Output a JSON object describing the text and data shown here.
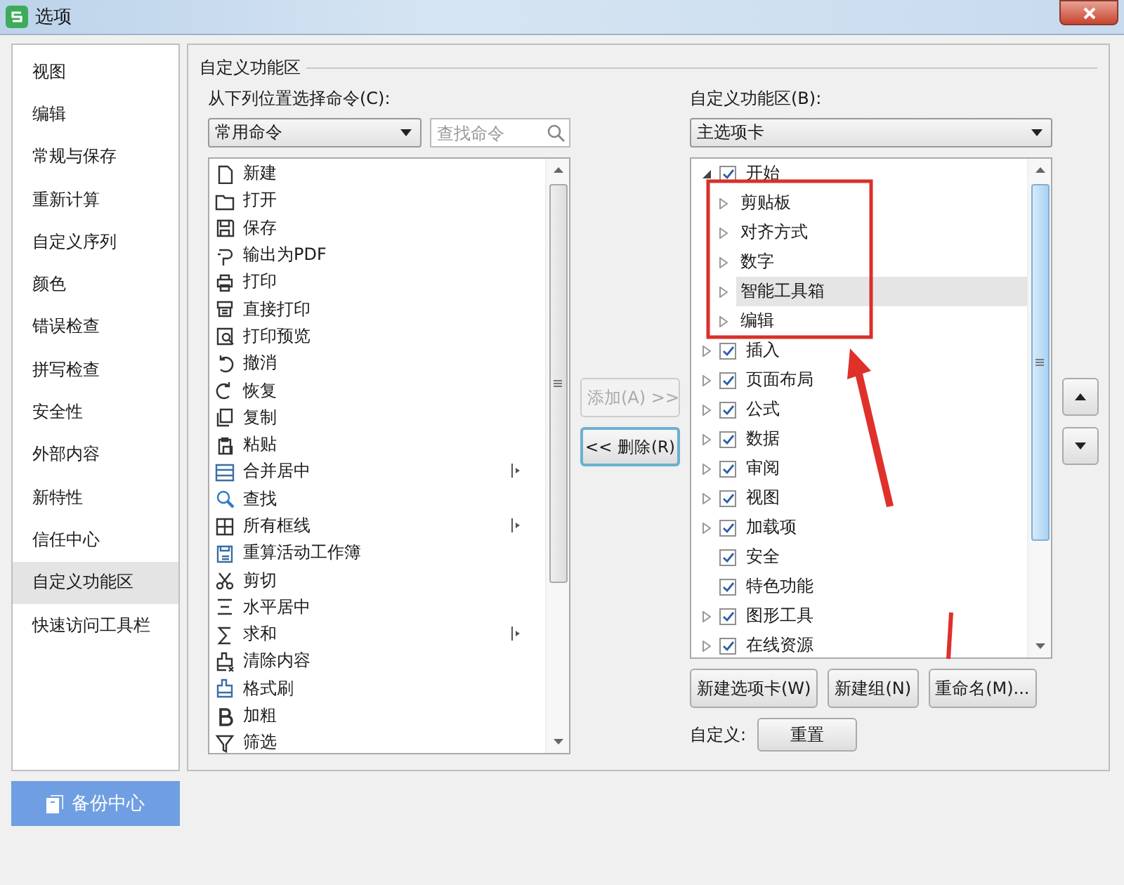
{
  "window": {
    "title": "选项"
  },
  "sidebar": {
    "items": [
      {
        "label": "视图",
        "selected": false
      },
      {
        "label": "编辑",
        "selected": false
      },
      {
        "label": "常规与保存",
        "selected": false
      },
      {
        "label": "重新计算",
        "selected": false
      },
      {
        "label": "自定义序列",
        "selected": false
      },
      {
        "label": "颜色",
        "selected": false
      },
      {
        "label": "错误检查",
        "selected": false
      },
      {
        "label": "拼写检查",
        "selected": false
      },
      {
        "label": "安全性",
        "selected": false
      },
      {
        "label": "外部内容",
        "selected": false
      },
      {
        "label": "新特性",
        "selected": false
      },
      {
        "label": "信任中心",
        "selected": false
      },
      {
        "label": "自定义功能区",
        "selected": true
      },
      {
        "label": "快速访问工具栏",
        "selected": false
      }
    ]
  },
  "backup_button": "备份中心",
  "section_title": "自定义功能区",
  "commands": {
    "label": "从下列位置选择命令(C):",
    "dropdown": "常用命令",
    "search": {
      "placeholder": "查找命令"
    },
    "items": [
      {
        "label": "新建",
        "submenu": false
      },
      {
        "label": "打开",
        "submenu": false
      },
      {
        "label": "保存",
        "submenu": false
      },
      {
        "label": "输出为PDF",
        "submenu": false
      },
      {
        "label": "打印",
        "submenu": false
      },
      {
        "label": "直接打印",
        "submenu": false
      },
      {
        "label": "打印预览",
        "submenu": false
      },
      {
        "label": "撤消",
        "submenu": false
      },
      {
        "label": "恢复",
        "submenu": false
      },
      {
        "label": "复制",
        "submenu": false
      },
      {
        "label": "粘贴",
        "submenu": false
      },
      {
        "label": "合并居中",
        "submenu": true
      },
      {
        "label": "查找",
        "submenu": false
      },
      {
        "label": "所有框线",
        "submenu": true
      },
      {
        "label": "重算活动工作簿",
        "submenu": false
      },
      {
        "label": "剪切",
        "submenu": false
      },
      {
        "label": "水平居中",
        "submenu": false
      },
      {
        "label": "求和",
        "submenu": true
      },
      {
        "label": "清除内容",
        "submenu": false
      },
      {
        "label": "格式刷",
        "submenu": false
      },
      {
        "label": "加粗",
        "submenu": false
      },
      {
        "label": "筛选",
        "submenu": false
      }
    ]
  },
  "add_button": {
    "label": "添加(A) >>",
    "disabled": true
  },
  "remove_button": {
    "label": "<< 删除(R)",
    "disabled": false
  },
  "ribbon": {
    "label": "自定义功能区(B):",
    "dropdown": "主选项卡",
    "tree": [
      {
        "label": "开始",
        "checked": true,
        "expandable": true,
        "expanded": true,
        "selected": false,
        "children": [
          {
            "label": "剪贴板",
            "expandable": true,
            "expanded": false,
            "selected": false
          },
          {
            "label": "对齐方式",
            "expandable": true,
            "expanded": false,
            "selected": false
          },
          {
            "label": "数字",
            "expandable": true,
            "expanded": false,
            "selected": false
          },
          {
            "label": "智能工具箱",
            "expandable": true,
            "expanded": false,
            "selected": true
          },
          {
            "label": "编辑",
            "expandable": true,
            "expanded": false,
            "selected": false
          }
        ]
      },
      {
        "label": "插入",
        "checked": true,
        "expandable": true,
        "expanded": false,
        "selected": false
      },
      {
        "label": "页面布局",
        "checked": true,
        "expandable": true,
        "expanded": false,
        "selected": false
      },
      {
        "label": "公式",
        "checked": true,
        "expandable": true,
        "expanded": false,
        "selected": false
      },
      {
        "label": "数据",
        "checked": true,
        "expandable": true,
        "expanded": false,
        "selected": false
      },
      {
        "label": "审阅",
        "checked": true,
        "expandable": true,
        "expanded": false,
        "selected": false
      },
      {
        "label": "视图",
        "checked": true,
        "expandable": true,
        "expanded": false,
        "selected": false
      },
      {
        "label": "加载项",
        "checked": true,
        "expandable": true,
        "expanded": false,
        "selected": false
      },
      {
        "label": "安全",
        "checked": true,
        "expandable": false,
        "selected": false
      },
      {
        "label": "特色功能",
        "checked": true,
        "expandable": false,
        "selected": false
      },
      {
        "label": "图形工具",
        "checked": true,
        "expandable": true,
        "expanded": false,
        "selected": false
      },
      {
        "label": "在线资源",
        "checked": true,
        "expandable": true,
        "expanded": false,
        "selected": false
      }
    ],
    "buttons": [
      "新建选项卡(W)",
      "新建组(N)",
      "重命名(M)..."
    ],
    "custom_label": "自定义:",
    "reset_button": "重置"
  },
  "annotations": [
    {
      "kind": "box"
    },
    {
      "kind": "arrow"
    },
    {
      "kind": "line"
    }
  ]
}
